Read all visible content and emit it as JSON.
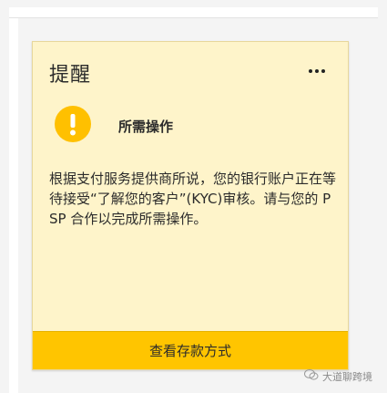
{
  "card": {
    "title": "提醒",
    "alert_label": "所需操作",
    "message": "根据支付服务提供商所说，您的银行账户正在等待接受“了解您的客户”(KYC)审核。请与您的 PSP 合作以完成所需操作。",
    "cta_label": "查看存款方式"
  },
  "icons": {
    "more": "more-horizontal-icon",
    "alert": "exclamation-icon",
    "wechat": "wechat-icon"
  },
  "watermark": {
    "text": "大道聊跨境"
  },
  "colors": {
    "card_bg": "#fef4ca",
    "accent": "#ffc000",
    "button": "#ffc500",
    "text": "#2b2b2b"
  }
}
